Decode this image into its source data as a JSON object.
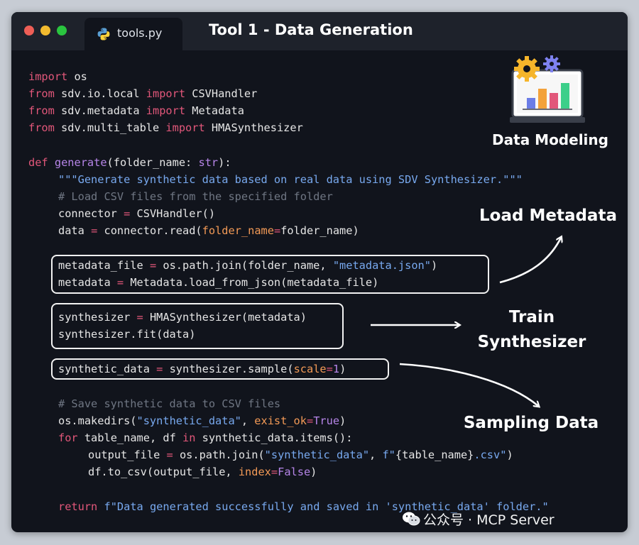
{
  "window": {
    "tab_label": "tools.py",
    "title": "Tool 1 - Data Generation"
  },
  "code": {
    "l1": [
      "import",
      " os"
    ],
    "l2": [
      "from",
      " sdv.io.local ",
      "import",
      " CSVHandler"
    ],
    "l3": [
      "from",
      " sdv.metadata ",
      "import",
      " Metadata"
    ],
    "l4": [
      "from",
      " sdv.multi_table ",
      "import",
      " HMASynthesizer"
    ],
    "l5": [
      "def",
      " ",
      "generate",
      "(folder_name: ",
      "str",
      "):"
    ],
    "l6": "\"\"\"Generate synthetic data based on real data using SDV Synthesizer.\"\"\"",
    "l7": "# Load CSV files from the specified folder",
    "l8": [
      "connector ",
      "=",
      " CSVHandler()"
    ],
    "l9": [
      "data ",
      "=",
      " connector.read(",
      "folder_name",
      "=",
      "folder_name)"
    ],
    "l10": [
      "metadata_file ",
      "=",
      " os.path.join(folder_name, ",
      "\"metadata.json\"",
      ")"
    ],
    "l11": [
      "metadata ",
      "=",
      " Metadata.load_from_json(metadata_file)"
    ],
    "l12": [
      "synthesizer ",
      "=",
      " HMASynthesizer(metadata)"
    ],
    "l13": "synthesizer.fit(data)",
    "l14": [
      "synthetic_data ",
      "=",
      " synthesizer.sample(",
      "scale",
      "=",
      "1",
      ")"
    ],
    "l15": "# Save synthetic data to CSV files",
    "l16": [
      "os.makedirs(",
      "\"synthetic_data\"",
      ", ",
      "exist_ok",
      "=",
      "True",
      ")"
    ],
    "l17": [
      "for",
      " table_name, df ",
      "in",
      " synthetic_data.items():"
    ],
    "l18": [
      "output_file ",
      "=",
      " os.path.join(",
      "\"synthetic_data\"",
      ", ",
      "f\"",
      "{table_name}",
      ".csv\"",
      ")"
    ],
    "l19": [
      "df.to_csv(output_file, ",
      "index",
      "=",
      "False",
      ")"
    ],
    "l20": [
      "return",
      " ",
      "f\"Data generated successfully and saved in 'synthetic_data' folder.\""
    ]
  },
  "annotations": {
    "data_modeling": "Data Modeling",
    "load_metadata": "Load Metadata",
    "train_line1": "Train",
    "train_line2": "Synthesizer",
    "sampling_data": "Sampling Data"
  },
  "watermark": "公众号 · MCP Server",
  "icons": {
    "tab": "python-icon",
    "illustration": "chart-monitor-gears-icon",
    "watermark": "wechat-icon"
  },
  "colors": {
    "background": "#11141c",
    "titlebar": "#1e222b",
    "keyword": "#e2577a",
    "function": "#b685e8",
    "string": "#78a9ef",
    "comment": "#6f7683",
    "argument": "#f39a56"
  }
}
